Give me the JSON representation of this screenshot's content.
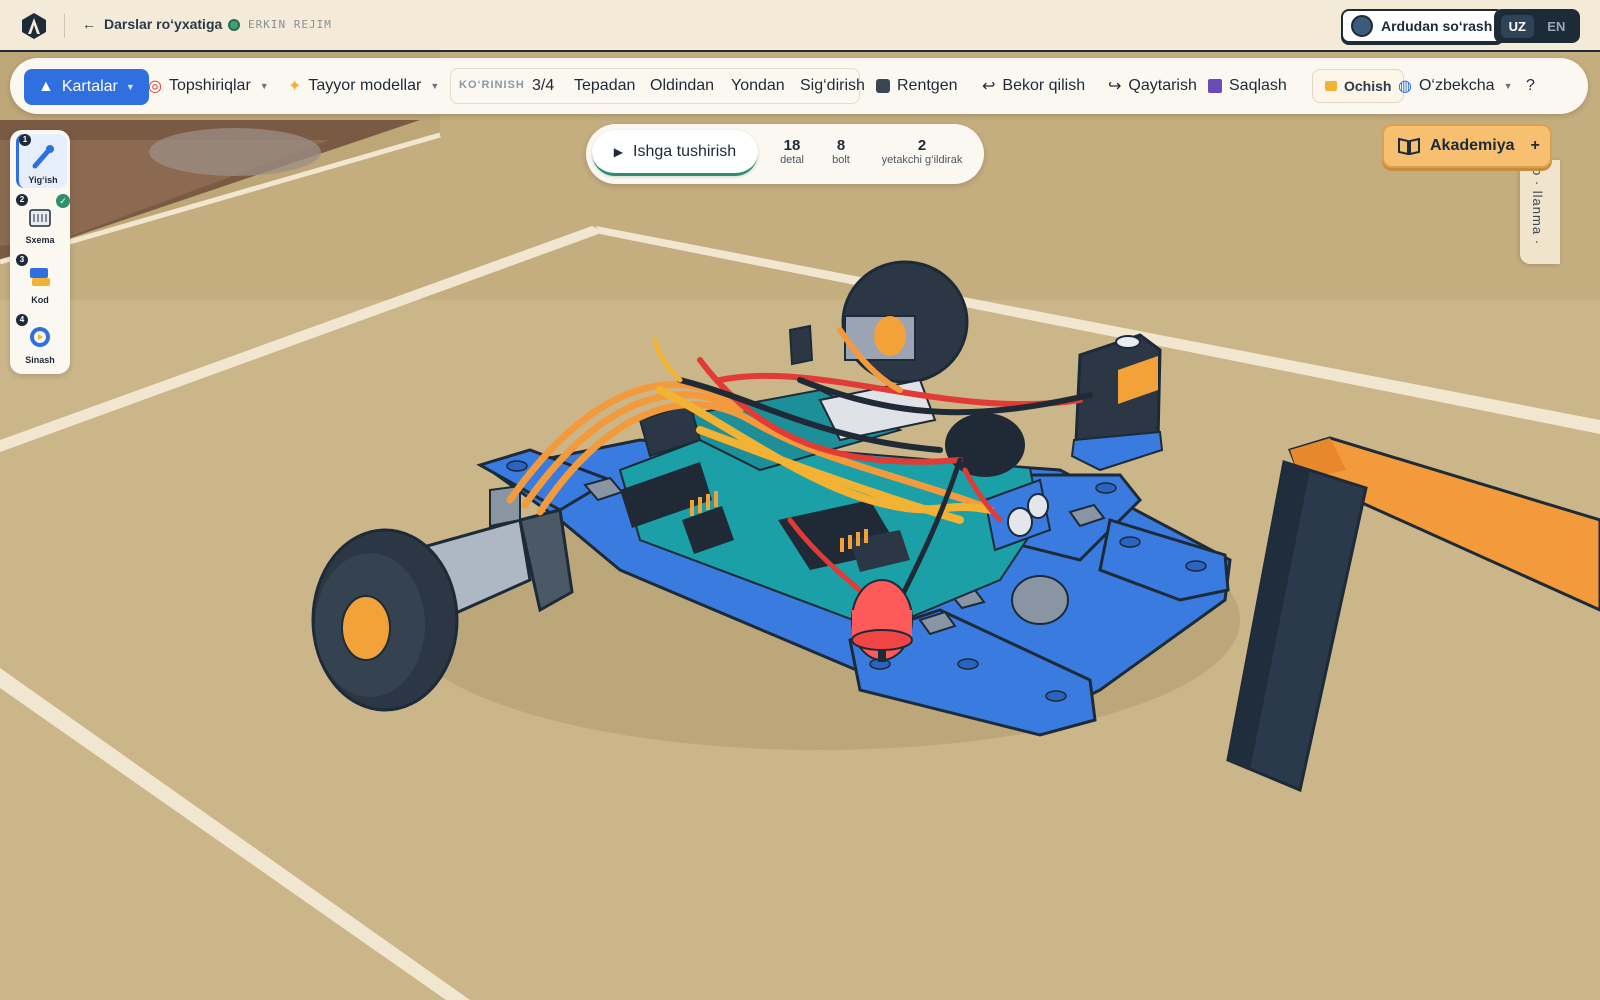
{
  "header": {
    "back_label": "Darslar ro‘yxatiga",
    "mode_label": "ERKIN REJIM",
    "ask_label": "Ardudan so‘rash",
    "lang_options": [
      "UZ",
      "EN"
    ],
    "lang_selected": "UZ"
  },
  "toolbar": {
    "cards_label": "Kartalar",
    "tasks_label": "Topshiriqlar",
    "models_label": "Tayyor modellar",
    "view_group_label": "KO‘RINISH",
    "view_options": [
      "3/4",
      "Tepadan",
      "Oldindan",
      "Yondan",
      "Sig‘dirish"
    ],
    "xray_label": "Rentgen",
    "undo_label": "Bekor qilish",
    "redo_label": "Qaytarish",
    "save_label": "Saqlash",
    "open_label": "Ochish",
    "language_label": "O‘zbekcha",
    "help_label": "?"
  },
  "steps": [
    {
      "num": "1",
      "label": "Yig‘ish",
      "active": true
    },
    {
      "num": "2",
      "label": "Sxema",
      "done": true
    },
    {
      "num": "3",
      "label": "Kod"
    },
    {
      "num": "4",
      "label": "Sinash"
    }
  ],
  "run_panel": {
    "run_label": "Ishga tushirish",
    "stats": [
      {
        "value": "18",
        "label": "detal"
      },
      {
        "value": "8",
        "label": "bolt"
      },
      {
        "value": "2",
        "label": "yetakchi g‘ildirak"
      }
    ]
  },
  "academy": {
    "label": "Akademiya",
    "plus": "+"
  },
  "side_tab": {
    "label": "o · llanma ·"
  },
  "colors": {
    "accent": "#2f6fe0",
    "topbar_bg": "#f3ead7",
    "floor": "#cbb68a",
    "robot_blue": "#3a7be0",
    "board_teal": "#179aa0",
    "academy": "#f7c071",
    "success": "#2e8f6e"
  }
}
